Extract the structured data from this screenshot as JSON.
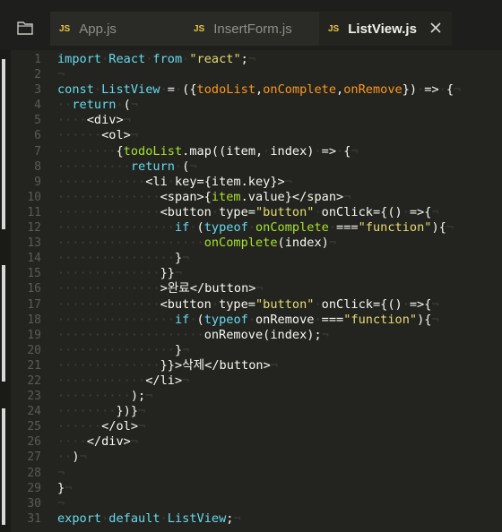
{
  "tabs": [
    {
      "badge": "JS",
      "label": "App.js",
      "active": false
    },
    {
      "badge": "JS",
      "label": "InsertForm.js",
      "active": false
    },
    {
      "badge": "JS",
      "label": "ListView.js",
      "active": true
    }
  ],
  "icons": {
    "sidebar": "folder-icon",
    "close": "close-icon",
    "js_badge_color": "#e8c44a"
  },
  "code_lines": [
    {
      "n": "1",
      "parts": [
        [
          "kw",
          "import"
        ],
        [
          "ws",
          "·"
        ],
        [
          "kw",
          "React"
        ],
        [
          "ws",
          "·"
        ],
        [
          "kw",
          "from"
        ],
        [
          "ws",
          "·"
        ],
        [
          "str",
          "\"react\""
        ],
        [
          "punc",
          ";"
        ],
        [
          "ws",
          "¬"
        ]
      ]
    },
    {
      "n": "2",
      "parts": [
        [
          "ws",
          "¬"
        ]
      ]
    },
    {
      "n": "3",
      "parts": [
        [
          "kw",
          "const"
        ],
        [
          "ws",
          "·"
        ],
        [
          "kw",
          "ListView"
        ],
        [
          "ws",
          "·"
        ],
        [
          "punc",
          "="
        ],
        [
          "ws",
          "·"
        ],
        [
          "punc",
          "({"
        ],
        [
          "param",
          "todoList"
        ],
        [
          "punc",
          ","
        ],
        [
          "param",
          "onComplete"
        ],
        [
          "punc",
          ","
        ],
        [
          "param",
          "onRemove"
        ],
        [
          "punc",
          "})"
        ],
        [
          "ws",
          "·"
        ],
        [
          "punc",
          "=>"
        ],
        [
          "ws",
          "·"
        ],
        [
          "punc",
          "{"
        ],
        [
          "ws",
          "¬"
        ]
      ]
    },
    {
      "n": "4",
      "parts": [
        [
          "ws",
          "··"
        ],
        [
          "kw",
          "return"
        ],
        [
          "ws",
          "·"
        ],
        [
          "punc",
          "("
        ],
        [
          "ws",
          "¬"
        ]
      ]
    },
    {
      "n": "5",
      "parts": [
        [
          "ws",
          "····"
        ],
        [
          "tag",
          "<div>"
        ],
        [
          "ws",
          "¬"
        ]
      ]
    },
    {
      "n": "6",
      "parts": [
        [
          "ws",
          "······"
        ],
        [
          "tag",
          "<ol>"
        ],
        [
          "ws",
          "¬"
        ]
      ]
    },
    {
      "n": "7",
      "parts": [
        [
          "ws",
          "········"
        ],
        [
          "punc",
          "{"
        ],
        [
          "fn",
          "todoList"
        ],
        [
          "punc",
          ".map((item,"
        ],
        [
          "ws",
          "·"
        ],
        [
          "punc",
          "index)"
        ],
        [
          "ws",
          "·"
        ],
        [
          "punc",
          "=>"
        ],
        [
          "ws",
          "·"
        ],
        [
          "punc",
          "{"
        ],
        [
          "ws",
          "¬"
        ]
      ]
    },
    {
      "n": "8",
      "parts": [
        [
          "ws",
          "··········"
        ],
        [
          "kw",
          "return"
        ],
        [
          "ws",
          "·"
        ],
        [
          "punc",
          "("
        ],
        [
          "ws",
          "¬"
        ]
      ]
    },
    {
      "n": "9",
      "parts": [
        [
          "ws",
          "············"
        ],
        [
          "tag",
          "<li"
        ],
        [
          "ws",
          "·"
        ],
        [
          "tag",
          "key={item.key}>"
        ],
        [
          "ws",
          "¬"
        ]
      ]
    },
    {
      "n": "10",
      "parts": [
        [
          "ws",
          "··············"
        ],
        [
          "tag",
          "<span>{"
        ],
        [
          "fn",
          "item"
        ],
        [
          "tag",
          ".value}</span>"
        ],
        [
          "ws",
          "¬"
        ]
      ]
    },
    {
      "n": "11",
      "parts": [
        [
          "ws",
          "··············"
        ],
        [
          "tag",
          "<button"
        ],
        [
          "ws",
          "·"
        ],
        [
          "tag",
          "type="
        ],
        [
          "str",
          "\"button\""
        ],
        [
          "ws",
          "·"
        ],
        [
          "tag",
          "onClick={()"
        ],
        [
          "ws",
          "·"
        ],
        [
          "tag",
          "=>{"
        ],
        [
          "ws",
          "¬"
        ]
      ]
    },
    {
      "n": "12",
      "parts": [
        [
          "ws",
          "················"
        ],
        [
          "kw",
          "if"
        ],
        [
          "ws",
          "·"
        ],
        [
          "punc",
          "("
        ],
        [
          "kw",
          "typeof"
        ],
        [
          "ws",
          "·"
        ],
        [
          "fn",
          "onComplete"
        ],
        [
          "ws",
          "·"
        ],
        [
          "punc",
          "==="
        ],
        [
          "str",
          "\"function\""
        ],
        [
          "punc",
          "){"
        ],
        [
          "ws",
          "¬"
        ]
      ]
    },
    {
      "n": "13",
      "parts": [
        [
          "ws",
          "····················"
        ],
        [
          "fn",
          "onComplete"
        ],
        [
          "punc",
          "(index)"
        ],
        [
          "ws",
          "¬"
        ]
      ]
    },
    {
      "n": "14",
      "parts": [
        [
          "ws",
          "················"
        ],
        [
          "punc",
          "}"
        ],
        [
          "ws",
          "¬"
        ]
      ]
    },
    {
      "n": "15",
      "parts": [
        [
          "ws",
          "··············"
        ],
        [
          "punc",
          "}}"
        ],
        [
          "ws",
          "¬"
        ]
      ]
    },
    {
      "n": "16",
      "parts": [
        [
          "ws",
          "··············"
        ],
        [
          "tag",
          ">완료</button>"
        ],
        [
          "ws",
          "¬"
        ]
      ]
    },
    {
      "n": "17",
      "parts": [
        [
          "ws",
          "··············"
        ],
        [
          "tag",
          "<button"
        ],
        [
          "ws",
          "·"
        ],
        [
          "tag",
          "type="
        ],
        [
          "str",
          "\"button\""
        ],
        [
          "ws",
          "·"
        ],
        [
          "tag",
          "onClick={()"
        ],
        [
          "ws",
          "·"
        ],
        [
          "tag",
          "=>{"
        ],
        [
          "ws",
          "¬"
        ]
      ]
    },
    {
      "n": "18",
      "parts": [
        [
          "ws",
          "················"
        ],
        [
          "kw",
          "if"
        ],
        [
          "ws",
          "·"
        ],
        [
          "punc",
          "("
        ],
        [
          "kw",
          "typeof"
        ],
        [
          "ws",
          "·"
        ],
        [
          "punc",
          "onRemove"
        ],
        [
          "ws",
          "·"
        ],
        [
          "punc",
          "==="
        ],
        [
          "str",
          "\"function\""
        ],
        [
          "punc",
          "){"
        ],
        [
          "ws",
          "¬"
        ]
      ]
    },
    {
      "n": "19",
      "parts": [
        [
          "ws",
          "····················"
        ],
        [
          "punc",
          "onRemove(index);"
        ],
        [
          "ws",
          "¬"
        ]
      ]
    },
    {
      "n": "20",
      "parts": [
        [
          "ws",
          "················"
        ],
        [
          "punc",
          "}"
        ],
        [
          "ws",
          "¬"
        ]
      ]
    },
    {
      "n": "21",
      "parts": [
        [
          "ws",
          "··············"
        ],
        [
          "tag",
          "}}>삭제</button>"
        ],
        [
          "ws",
          "¬"
        ]
      ]
    },
    {
      "n": "22",
      "parts": [
        [
          "ws",
          "············"
        ],
        [
          "tag",
          "</li>"
        ],
        [
          "ws",
          "¬"
        ]
      ]
    },
    {
      "n": "23",
      "parts": [
        [
          "ws",
          "··········"
        ],
        [
          "punc",
          ");"
        ],
        [
          "ws",
          "¬"
        ]
      ]
    },
    {
      "n": "24",
      "parts": [
        [
          "ws",
          "········"
        ],
        [
          "punc",
          "})}"
        ],
        [
          "ws",
          "¬"
        ]
      ]
    },
    {
      "n": "25",
      "parts": [
        [
          "ws",
          "······"
        ],
        [
          "tag",
          "</ol>"
        ],
        [
          "ws",
          "¬"
        ]
      ]
    },
    {
      "n": "26",
      "parts": [
        [
          "ws",
          "····"
        ],
        [
          "tag",
          "</div>"
        ],
        [
          "ws",
          "¬"
        ]
      ]
    },
    {
      "n": "27",
      "parts": [
        [
          "ws",
          "··"
        ],
        [
          "punc",
          ")"
        ],
        [
          "ws",
          "¬"
        ]
      ]
    },
    {
      "n": "28",
      "parts": [
        [
          "ws",
          "¬"
        ]
      ]
    },
    {
      "n": "29",
      "parts": [
        [
          "punc",
          "}"
        ],
        [
          "ws",
          "¬"
        ]
      ]
    },
    {
      "n": "30",
      "parts": [
        [
          "ws",
          "¬"
        ]
      ]
    },
    {
      "n": "31",
      "parts": [
        [
          "kw",
          "export"
        ],
        [
          "ws",
          "·"
        ],
        [
          "kw",
          "default"
        ],
        [
          "ws",
          "·"
        ],
        [
          "kw",
          "ListView"
        ],
        [
          "punc",
          ";"
        ],
        [
          "ws",
          "¬"
        ]
      ]
    }
  ]
}
